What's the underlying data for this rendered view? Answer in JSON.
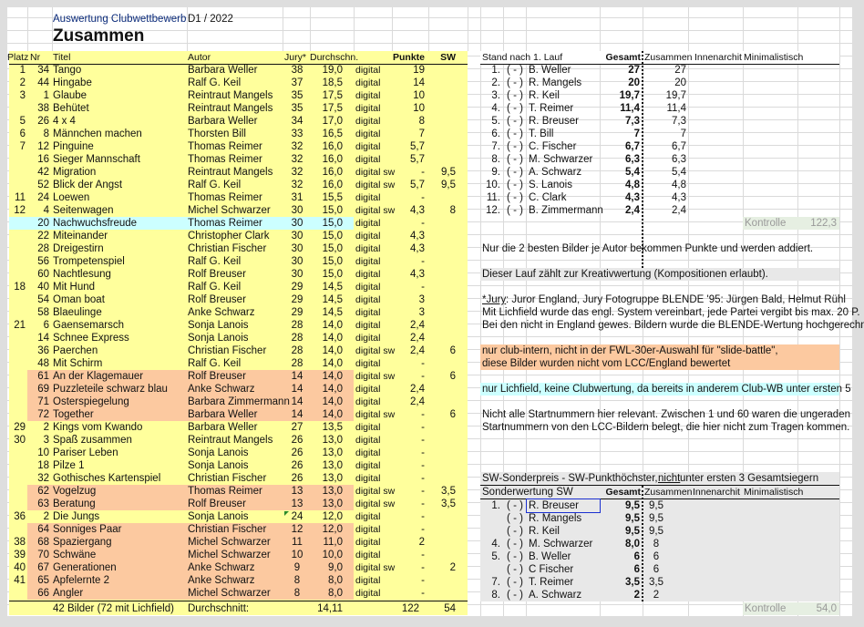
{
  "sheet": {
    "subtitle": "Auswertung Clubwettbewerb",
    "run": "D1 / 2022",
    "title": "Zusammen"
  },
  "colors": {
    "yellow": "#ffff9c",
    "orange": "#fcc9a0",
    "blue": "#ccffff",
    "gray": "#e8e8e8"
  },
  "main": {
    "headers": {
      "platz": "Platz",
      "nr": "Nr",
      "titel": "Titel",
      "autor": "Autor",
      "jury": "Jury*",
      "durch": "Durchschn.",
      "punkte": "Punkte",
      "sw": "SW"
    },
    "rows": [
      {
        "platz": "1",
        "nr": "34",
        "titel": "Tango",
        "autor": "Barbara Weller",
        "jury": "38",
        "durch": "19,0",
        "typ": "digital",
        "punkte": "19",
        "sw": ""
      },
      {
        "platz": "2",
        "nr": "44",
        "titel": "Hingabe",
        "autor": "Ralf G. Keil",
        "jury": "37",
        "durch": "18,5",
        "typ": "digital",
        "punkte": "14",
        "sw": ""
      },
      {
        "platz": "3",
        "nr": "1",
        "titel": "Glaube",
        "autor": "Reintraut Mangels",
        "jury": "35",
        "durch": "17,5",
        "typ": "digital",
        "punkte": "10",
        "sw": ""
      },
      {
        "platz": "",
        "nr": "38",
        "titel": "Behütet",
        "autor": "Reintraut Mangels",
        "jury": "35",
        "durch": "17,5",
        "typ": "digital",
        "punkte": "10",
        "sw": ""
      },
      {
        "platz": "5",
        "nr": "26",
        "titel": "4 x 4",
        "autor": "Barbara Weller",
        "jury": "34",
        "durch": "17,0",
        "typ": "digital",
        "punkte": "8",
        "sw": ""
      },
      {
        "platz": "6",
        "nr": "8",
        "titel": "Männchen machen",
        "autor": "Thorsten Bill",
        "jury": "33",
        "durch": "16,5",
        "typ": "digital",
        "punkte": "7",
        "sw": ""
      },
      {
        "platz": "7",
        "nr": "12",
        "titel": "Pinguine",
        "autor": "Thomas Reimer",
        "jury": "32",
        "durch": "16,0",
        "typ": "digital",
        "punkte": "5,7",
        "sw": ""
      },
      {
        "platz": "",
        "nr": "16",
        "titel": "Sieger Mannschaft",
        "autor": "Thomas Reimer",
        "jury": "32",
        "durch": "16,0",
        "typ": "digital",
        "punkte": "5,7",
        "sw": ""
      },
      {
        "platz": "",
        "nr": "42",
        "titel": "Migration",
        "autor": "Reintraut Mangels",
        "jury": "32",
        "durch": "16,0",
        "typ": "digital sw",
        "punkte": "-",
        "sw": "9,5"
      },
      {
        "platz": "",
        "nr": "52",
        "titel": "Blick der Angst",
        "autor": "Ralf G. Keil",
        "jury": "32",
        "durch": "16,0",
        "typ": "digital sw",
        "punkte": "5,7",
        "sw": "9,5"
      },
      {
        "platz": "11",
        "nr": "24",
        "titel": "Loewen",
        "autor": "Thomas Reimer",
        "jury": "31",
        "durch": "15,5",
        "typ": "digital",
        "punkte": "-",
        "sw": ""
      },
      {
        "platz": "12",
        "nr": "4",
        "titel": "Seitenwagen",
        "autor": "Michel Schwarzer",
        "jury": "30",
        "durch": "15,0",
        "typ": "digital sw",
        "punkte": "4,3",
        "sw": "8"
      },
      {
        "platz": "",
        "nr": "20",
        "titel": "Nachwuchsfreude",
        "autor": "Thomas Reimer",
        "jury": "30",
        "durch": "15,0",
        "typ": "digital",
        "punkte": "-",
        "sw": "",
        "hl": "blue"
      },
      {
        "platz": "",
        "nr": "22",
        "titel": "Miteinander",
        "autor": "Christopher Clark",
        "jury": "30",
        "durch": "15,0",
        "typ": "digital",
        "punkte": "4,3",
        "sw": ""
      },
      {
        "platz": "",
        "nr": "28",
        "titel": "Dreigestirn",
        "autor": "Christian Fischer",
        "jury": "30",
        "durch": "15,0",
        "typ": "digital",
        "punkte": "4,3",
        "sw": ""
      },
      {
        "platz": "",
        "nr": "56",
        "titel": "Trompetenspiel",
        "autor": "Ralf G. Keil",
        "jury": "30",
        "durch": "15,0",
        "typ": "digital",
        "punkte": "-",
        "sw": ""
      },
      {
        "platz": "",
        "nr": "60",
        "titel": "Nachtlesung",
        "autor": "Rolf Breuser",
        "jury": "30",
        "durch": "15,0",
        "typ": "digital",
        "punkte": "4,3",
        "sw": ""
      },
      {
        "platz": "18",
        "nr": "40",
        "titel": "Mit Hund",
        "autor": "Ralf G. Keil",
        "jury": "29",
        "durch": "14,5",
        "typ": "digital",
        "punkte": "-",
        "sw": ""
      },
      {
        "platz": "",
        "nr": "54",
        "titel": "Oman boat",
        "autor": "Rolf Breuser",
        "jury": "29",
        "durch": "14,5",
        "typ": "digital",
        "punkte": "3",
        "sw": ""
      },
      {
        "platz": "",
        "nr": "58",
        "titel": "Blaeulinge",
        "autor": "Anke Schwarz",
        "jury": "29",
        "durch": "14,5",
        "typ": "digital",
        "punkte": "3",
        "sw": ""
      },
      {
        "platz": "21",
        "nr": "6",
        "titel": "Gaensemarsch",
        "autor": "Sonja Lanois",
        "jury": "28",
        "durch": "14,0",
        "typ": "digital",
        "punkte": "2,4",
        "sw": ""
      },
      {
        "platz": "",
        "nr": "14",
        "titel": "Schnee Express",
        "autor": "Sonja Lanois",
        "jury": "28",
        "durch": "14,0",
        "typ": "digital",
        "punkte": "2,4",
        "sw": ""
      },
      {
        "platz": "",
        "nr": "36",
        "titel": "Paerchen",
        "autor": "Christian Fischer",
        "jury": "28",
        "durch": "14,0",
        "typ": "digital sw",
        "punkte": "2,4",
        "sw": "6"
      },
      {
        "platz": "",
        "nr": "48",
        "titel": "Mit Schirm",
        "autor": "Ralf G. Keil",
        "jury": "28",
        "durch": "14,0",
        "typ": "digital",
        "punkte": "-",
        "sw": ""
      },
      {
        "platz": "",
        "nr": "61",
        "titel": "An der Klagemauer",
        "autor": "Rolf Breuser",
        "jury": "14",
        "durch": "14,0",
        "typ": "digital sw",
        "punkte": "-",
        "sw": "6",
        "hl": "orange"
      },
      {
        "platz": "",
        "nr": "69",
        "titel": "Puzzleteile schwarz blau",
        "autor": "Anke Schwarz",
        "jury": "14",
        "durch": "14,0",
        "typ": "digital",
        "punkte": "2,4",
        "sw": "",
        "hl": "orange"
      },
      {
        "platz": "",
        "nr": "71",
        "titel": "Osterspiegelung",
        "autor": "Barbara Zimmermann",
        "jury": "14",
        "durch": "14,0",
        "typ": "digital",
        "punkte": "2,4",
        "sw": "",
        "hl": "orange"
      },
      {
        "platz": "",
        "nr": "72",
        "titel": "Together",
        "autor": "Barbara Weller",
        "jury": "14",
        "durch": "14,0",
        "typ": "digital sw",
        "punkte": "-",
        "sw": "6",
        "hl": "orange"
      },
      {
        "platz": "29",
        "nr": "2",
        "titel": "Kings vom Kwando",
        "autor": "Barbara Weller",
        "jury": "27",
        "durch": "13,5",
        "typ": "digital",
        "punkte": "-",
        "sw": ""
      },
      {
        "platz": "30",
        "nr": "3",
        "titel": "Spaß zusammen",
        "autor": "Reintraut Mangels",
        "jury": "26",
        "durch": "13,0",
        "typ": "digital",
        "punkte": "-",
        "sw": ""
      },
      {
        "platz": "",
        "nr": "10",
        "titel": "Pariser Leben",
        "autor": "Sonja Lanois",
        "jury": "26",
        "durch": "13,0",
        "typ": "digital",
        "punkte": "-",
        "sw": ""
      },
      {
        "platz": "",
        "nr": "18",
        "titel": "Pilze 1",
        "autor": "Sonja Lanois",
        "jury": "26",
        "durch": "13,0",
        "typ": "digital",
        "punkte": "-",
        "sw": ""
      },
      {
        "platz": "",
        "nr": "32",
        "titel": "Gothisches Kartenspiel",
        "autor": "Christian Fischer",
        "jury": "26",
        "durch": "13,0",
        "typ": "digital",
        "punkte": "-",
        "sw": ""
      },
      {
        "platz": "",
        "nr": "62",
        "titel": "Vogelzug",
        "autor": "Thomas Reimer",
        "jury": "13",
        "durch": "13,0",
        "typ": "digital sw",
        "punkte": "-",
        "sw": "3,5",
        "hl": "orange"
      },
      {
        "platz": "",
        "nr": "63",
        "titel": "Beratung",
        "autor": "Rolf Breuser",
        "jury": "13",
        "durch": "13,0",
        "typ": "digital sw",
        "punkte": "-",
        "sw": "3,5",
        "hl": "orange"
      },
      {
        "platz": "36",
        "nr": "2",
        "titel": "Die Jungs",
        "autor": "Sonja Lanois",
        "jury": "24",
        "durch": "12,0",
        "typ": "digital",
        "punkte": "-",
        "sw": "",
        "comment": true
      },
      {
        "platz": "",
        "nr": "64",
        "titel": "Sonniges Paar",
        "autor": "Christian Fischer",
        "jury": "12",
        "durch": "12,0",
        "typ": "digital",
        "punkte": "-",
        "sw": "",
        "hl": "orange"
      },
      {
        "platz": "38",
        "nr": "68",
        "titel": "Spaziergang",
        "autor": "Michel Schwarzer",
        "jury": "11",
        "durch": "11,0",
        "typ": "digital",
        "punkte": "2",
        "sw": "",
        "hl": "orange"
      },
      {
        "platz": "39",
        "nr": "70",
        "titel": "Schwäne",
        "autor": "Michel Schwarzer",
        "jury": "10",
        "durch": "10,0",
        "typ": "digital",
        "punkte": "-",
        "sw": "",
        "hl": "orange"
      },
      {
        "platz": "40",
        "nr": "67",
        "titel": "Generationen",
        "autor": "Anke Schwarz",
        "jury": "9",
        "durch": "9,0",
        "typ": "digital sw",
        "punkte": "-",
        "sw": "2",
        "hl": "orange"
      },
      {
        "platz": "41",
        "nr": "65",
        "titel": "Apfelernte 2",
        "autor": "Anke Schwarz",
        "jury": "8",
        "durch": "8,0",
        "typ": "digital",
        "punkte": "-",
        "sw": "",
        "hl": "orange"
      },
      {
        "platz": "",
        "nr": "66",
        "titel": "Angler",
        "autor": "Michel Schwarzer",
        "jury": "8",
        "durch": "8,0",
        "typ": "digital",
        "punkte": "-",
        "sw": "",
        "hl": "orange"
      }
    ],
    "footer": {
      "count": "42 Bilder (72 mit Lichfield)",
      "avg_label": "Durchschnitt:",
      "avg": "14,11",
      "punkte": "122",
      "sw": "54"
    }
  },
  "standings": {
    "headers": {
      "title": "Stand nach 1. Lauf",
      "gesamt": "Gesamt",
      "zusammen": "Zusammen",
      "innen": "Innenarchit",
      "mini": "Minimalistisch"
    },
    "rows": [
      {
        "rank": "1.",
        "chg": "( - )",
        "name": "B. Weller",
        "gesamt": "27",
        "zus": "27"
      },
      {
        "rank": "2.",
        "chg": "( - )",
        "name": "R. Mangels",
        "gesamt": "20",
        "zus": "20"
      },
      {
        "rank": "3.",
        "chg": "( - )",
        "name": "R. Keil",
        "gesamt": "19,7",
        "zus": "19,7"
      },
      {
        "rank": "4.",
        "chg": "( - )",
        "name": "T. Reimer",
        "gesamt": "11,4",
        "zus": "11,4"
      },
      {
        "rank": "5.",
        "chg": "( - )",
        "name": "R. Breuser",
        "gesamt": "7,3",
        "zus": "7,3"
      },
      {
        "rank": "6.",
        "chg": "( - )",
        "name": "T. Bill",
        "gesamt": "7",
        "zus": "7"
      },
      {
        "rank": "7.",
        "chg": "( - )",
        "name": "C. Fischer",
        "gesamt": "6,7",
        "zus": "6,7"
      },
      {
        "rank": "8.",
        "chg": "( - )",
        "name": "M. Schwarzer",
        "gesamt": "6,3",
        "zus": "6,3"
      },
      {
        "rank": "9.",
        "chg": "( - )",
        "name": "A. Schwarz",
        "gesamt": "5,4",
        "zus": "5,4"
      },
      {
        "rank": "10.",
        "chg": "( - )",
        "name": "S. Lanois",
        "gesamt": "4,8",
        "zus": "4,8"
      },
      {
        "rank": "11.",
        "chg": "( - )",
        "name": "C. Clark",
        "gesamt": "4,3",
        "zus": "4,3"
      },
      {
        "rank": "12.",
        "chg": "( - )",
        "name": "B. Zimmermann",
        "gesamt": "2,4",
        "zus": "2,4"
      }
    ],
    "kontrolle_label": "Kontrolle",
    "kontrolle": "122,3"
  },
  "notes": {
    "best2": "Nur die 2 besten Bilder je Autor bekommen Punkte und werden addiert.",
    "kreativ": "Dieser Lauf zählt zur Kreativwertung (Kompositionen erlaubt).",
    "jury_label": "*Jury",
    "jury1": ": Juror England, Jury Fotogruppe BLENDE '95: Jürgen Bald, Helmut Rühl",
    "jury2": "Mit Lichfield wurde das engl. System vereinbart, jede Partei vergibt bis max. 20 P.",
    "jury3": "Bei den nicht in England gewes. Bildern wurde die BLENDE-Wertung hochgerechnet",
    "orange1": "nur club-intern, nicht in der FWL-30er-Auswahl für \"slide-battle\",",
    "orange2": "diese Bilder wurden nicht vom LCC/England bewertet",
    "blue": "nur Lichfield, keine Clubwertung, da bereits in anderem Club-WB unter ersten 5",
    "start1": "Nicht alle Startnummern hier relevant. Zwischen 1 und 60 waren die ungeraden",
    "start2": "Startnummern von den LCC-Bildern belegt, die hier nicht zum Tragen kommen."
  },
  "sw": {
    "title_a": "SW-Sonderpreis - SW-Punkthöchster, ",
    "title_u": "nicht",
    "title_b": " unter ersten 3 Gesamtsiegern",
    "headers": {
      "title": "Sonderwertung SW",
      "gesamt": "Gesamt",
      "zusammen": "Zusammen",
      "innen": "Innenarchit",
      "mini": "Minimalistisch"
    },
    "rows": [
      {
        "rank": "1.",
        "chg": "( - )",
        "name": "R. Breuser",
        "gesamt": "9,5",
        "zus": "9,5",
        "selected": true
      },
      {
        "rank": "",
        "chg": "( - )",
        "name": "R. Mangels",
        "gesamt": "9,5",
        "zus": "9,5"
      },
      {
        "rank": "",
        "chg": "( - )",
        "name": "R. Keil",
        "gesamt": "9,5",
        "zus": "9,5"
      },
      {
        "rank": "4.",
        "chg": "( - )",
        "name": "M. Schwarzer",
        "gesamt": "8,0",
        "zus": "8"
      },
      {
        "rank": "5.",
        "chg": "( - )",
        "name": "B. Weller",
        "gesamt": "6",
        "zus": "6"
      },
      {
        "rank": "",
        "chg": "( - )",
        "name": "C Fischer",
        "gesamt": "6",
        "zus": "6"
      },
      {
        "rank": "7.",
        "chg": "( - )",
        "name": "T. Reimer",
        "gesamt": "3,5",
        "zus": "3,5"
      },
      {
        "rank": "8.",
        "chg": "( - )",
        "name": "A. Schwarz",
        "gesamt": "2",
        "zus": "2"
      }
    ],
    "kontrolle_label": "Kontrolle",
    "kontrolle": "54,0"
  }
}
